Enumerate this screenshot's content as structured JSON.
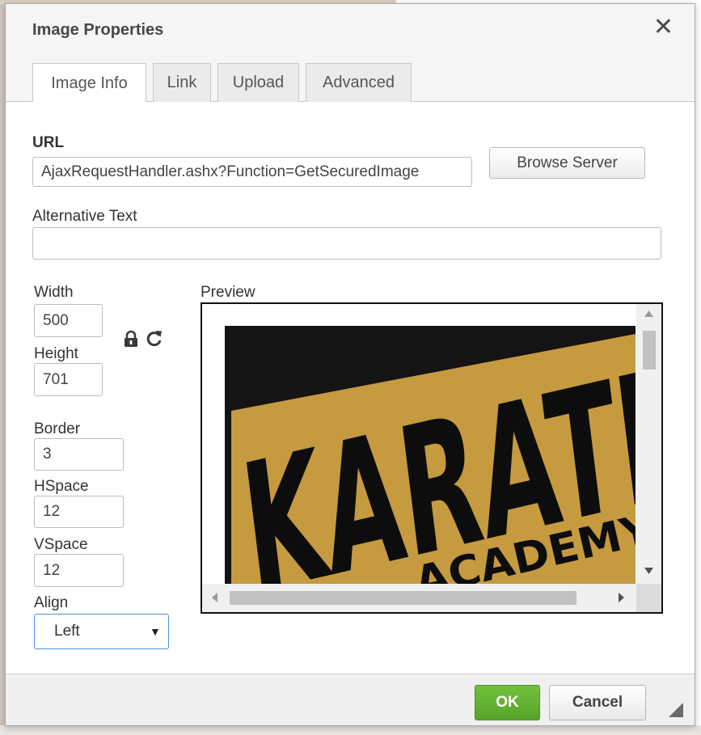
{
  "dialog": {
    "title": "Image Properties",
    "close_icon": "close-icon"
  },
  "tabs": [
    {
      "label": "Image Info",
      "active": true
    },
    {
      "label": "Link",
      "active": false
    },
    {
      "label": "Upload",
      "active": false
    },
    {
      "label": "Advanced",
      "active": false
    }
  ],
  "image_info": {
    "url_label": "URL",
    "url_value": "AjaxRequestHandler.ashx?Function=GetSecuredImage",
    "browse_label": "Browse Server",
    "alt_label": "Alternative Text",
    "alt_value": "",
    "width_label": "Width",
    "width_value": "500",
    "height_label": "Height",
    "height_value": "701",
    "lock_icon": "lock-icon",
    "reset_icon": "reset-size-icon",
    "border_label": "Border",
    "border_value": "3",
    "hspace_label": "HSpace",
    "hspace_value": "12",
    "vspace_label": "VSpace",
    "vspace_value": "12",
    "align_label": "Align",
    "align_value": "Left",
    "preview_label": "Preview"
  },
  "preview_image": {
    "text": "KARATE",
    "subtext": "ACADEMY",
    "colors": {
      "background": "#141414",
      "banner": "#c69a3f",
      "letters": "#0d0d0d"
    }
  },
  "footer": {
    "ok_label": "OK",
    "cancel_label": "Cancel"
  },
  "colors": {
    "ok_green": "#62b22f",
    "focus_blue": "#4a90e2"
  }
}
